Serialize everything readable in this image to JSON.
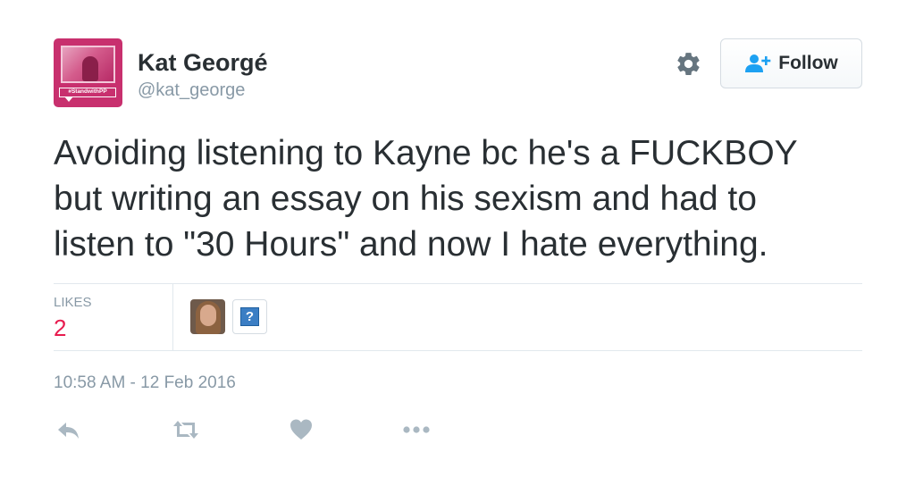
{
  "user": {
    "name": "Kat Georgé",
    "handle": "@kat_george",
    "avatar_banner_text": "#StandwithPP"
  },
  "follow_button": {
    "label": "Follow"
  },
  "tweet": {
    "lines": [
      "Avoiding listening to Kayne bc he's a FUCKBOY",
      "but writing an essay on his sexism and had to",
      "listen to \"30 Hours\" and now I hate everything."
    ],
    "timestamp": "10:58 AM - 12 Feb 2016"
  },
  "stats": {
    "likes_label": "LIKES",
    "likes_count": "2",
    "liker_placeholder_glyph": "?"
  },
  "icons": {
    "settings": "gear-icon",
    "follow": "add-user-icon",
    "reply": "reply-icon",
    "retweet": "retweet-icon",
    "like": "heart-icon",
    "more": "more-icon"
  },
  "colors": {
    "text": "#292f33",
    "muted": "#8899a6",
    "like_count": "#e81c4f",
    "follow_icon": "#1da1f2",
    "divider": "#e1e8ed",
    "action_icon": "#aab8c2"
  }
}
